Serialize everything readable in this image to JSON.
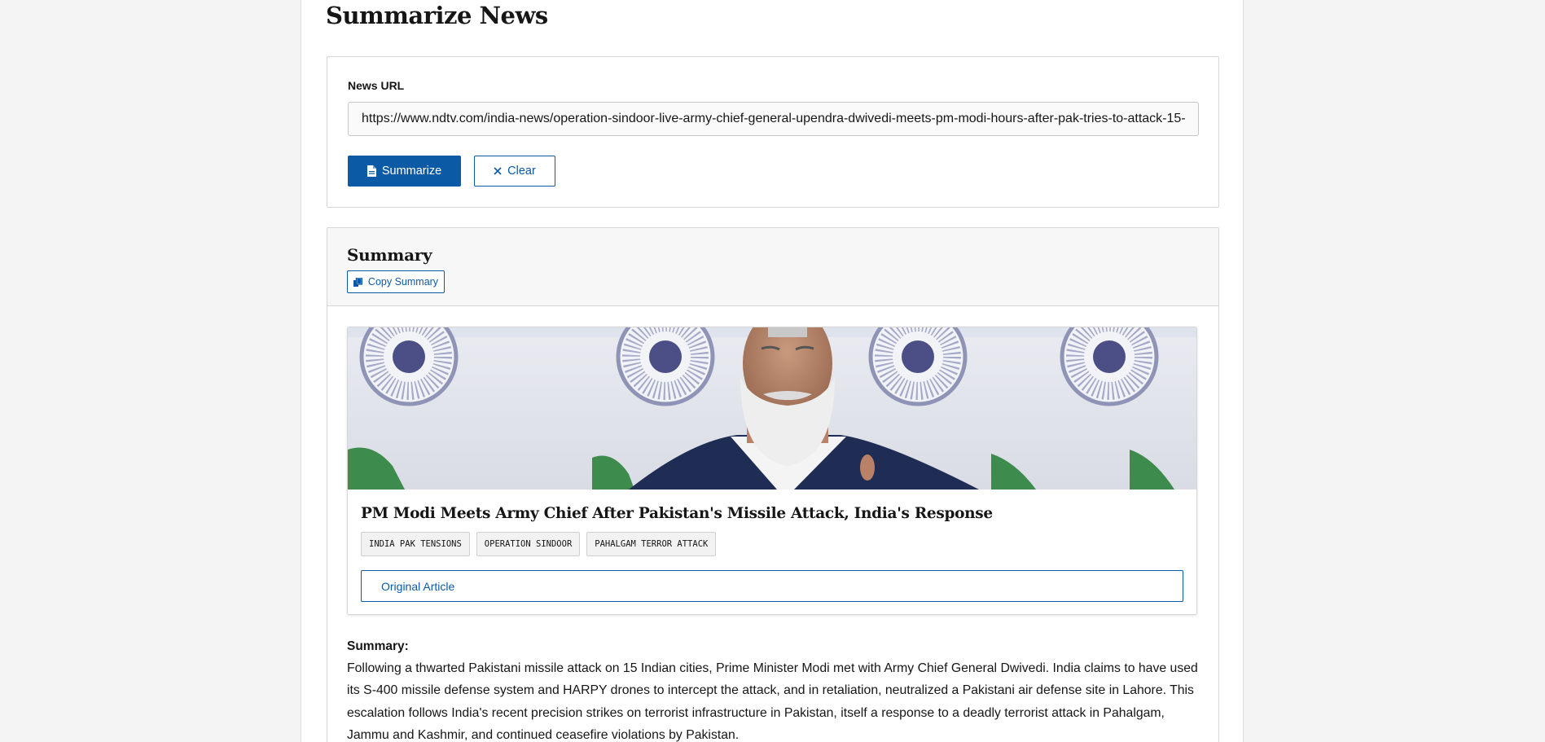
{
  "page": {
    "title": "Summarize News"
  },
  "form": {
    "url_label": "News URL",
    "url_value": "https://www.ndtv.com/india-news/operation-sindoor-live-army-chief-general-upendra-dwivedi-meets-pm-modi-hours-after-pak-tries-to-attack-15-",
    "summarize_label": "Summarize",
    "clear_label": "Clear"
  },
  "summary": {
    "heading": "Summary",
    "copy_label": "Copy Summary",
    "article": {
      "title": "PM Modi Meets Army Chief After Pakistan's Missile Attack, India's Response",
      "tags": [
        "INDIA PAK TENSIONS",
        "OPERATION SINDOOR",
        "PAHALGAM TERROR ATTACK"
      ],
      "original_label": "Original Article"
    },
    "label": "Summary:",
    "text": "Following a thwarted Pakistani missile attack on 15 Indian cities, Prime Minister Modi met with Army Chief General Dwivedi. India claims to have used its S-400 missile defense system and HARPY drones to intercept the attack, and in retaliation, neutralized a Pakistani air defense site in Lahore. This escalation follows India's recent precision strikes on terrorist infrastructure in Pakistan, itself a response to a deadly terrorist attack in Pahalgam, Jammu and Kashmir, and continued ceasefire violations by Pakistan."
  },
  "colors": {
    "accent": "#0b5aa6",
    "page_background": "#f4f4f4",
    "card_border": "#d6d6d6"
  }
}
